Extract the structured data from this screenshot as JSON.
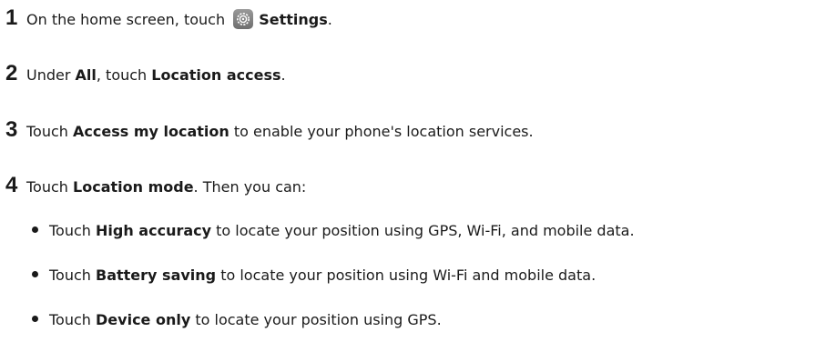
{
  "steps": [
    {
      "num": "1",
      "pre": "On the home screen, touch",
      "bold": "Settings",
      "post": "."
    },
    {
      "num": "2",
      "pre": "Under ",
      "bold1": "All",
      "mid": ", touch ",
      "bold2": "Location access",
      "post": "."
    },
    {
      "num": "3",
      "pre": "Touch ",
      "bold": "Access my location",
      "post": " to enable your phone's location services."
    },
    {
      "num": "4",
      "pre": "Touch ",
      "bold": "Location mode",
      "post": ". Then you can:"
    }
  ],
  "bullets": [
    {
      "pre": "Touch ",
      "bold": "High accuracy",
      "post": " to locate your position using GPS, Wi-Fi, and mobile data."
    },
    {
      "pre": "Touch ",
      "bold": "Battery saving",
      "post": " to locate your position using Wi-Fi and mobile data."
    },
    {
      "pre": "Touch ",
      "bold": "Device only",
      "post": " to locate your position using GPS."
    }
  ],
  "icons": {
    "settings": "gear-icon"
  },
  "colors": {
    "text": "#1a1a1a",
    "icon_bg": "#7f7f7f"
  }
}
